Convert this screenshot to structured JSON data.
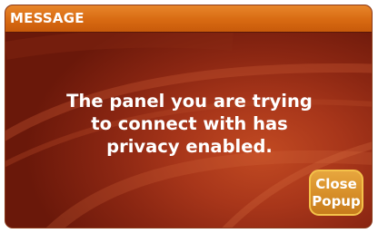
{
  "dialog": {
    "title": "MESSAGE",
    "message_line_1": "The panel you are trying",
    "message_line_2": "to connect with has",
    "message_line_3": "privacy enabled.",
    "close_button_label": "Close\nPopup"
  },
  "colors": {
    "title_bar": "#d86a12",
    "body_background": "#9a2e16",
    "button_fill": "#d8902a",
    "button_border": "#f4c24a",
    "text": "#ffffff"
  }
}
